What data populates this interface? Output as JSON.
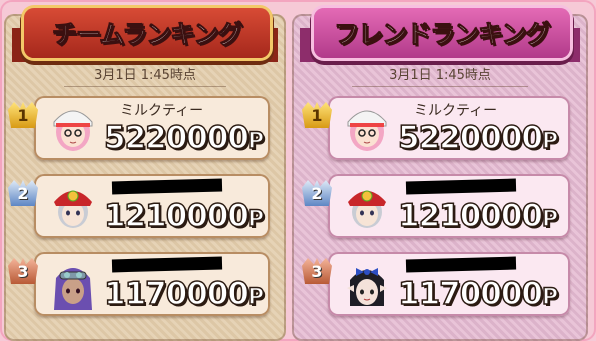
{
  "panels": [
    {
      "title": "チームランキング",
      "timestamp": "3月1日 1:45時点",
      "entries": [
        {
          "rank": "1",
          "name": "ミルクティー",
          "score": "5220000",
          "unit": "P",
          "avatar": "pink-hair-white-cap"
        },
        {
          "rank": "2",
          "name": "",
          "score": "1210000",
          "unit": "P",
          "avatar": "red-bandana-gray-hair"
        },
        {
          "rank": "3",
          "name": "",
          "score": "1170000",
          "unit": "P",
          "avatar": "purple-hair-goggles"
        }
      ]
    },
    {
      "title": "フレンドランキング",
      "timestamp": "3月1日 1:45時点",
      "entries": [
        {
          "rank": "1",
          "name": "ミルクティー",
          "score": "5220000",
          "unit": "P",
          "avatar": "pink-hair-white-cap"
        },
        {
          "rank": "2",
          "name": "",
          "score": "1210000",
          "unit": "P",
          "avatar": "red-bandana-gray-hair"
        },
        {
          "rank": "3",
          "name": "",
          "score": "1170000",
          "unit": "P",
          "avatar": "black-hair-blue-bow"
        }
      ]
    }
  ],
  "colors": {
    "team_ribbon": "#c23a28",
    "friend_ribbon": "#d153a4",
    "rank1": "#f0c23a",
    "rank2": "#5e86c4",
    "rank3": "#c46a46"
  }
}
